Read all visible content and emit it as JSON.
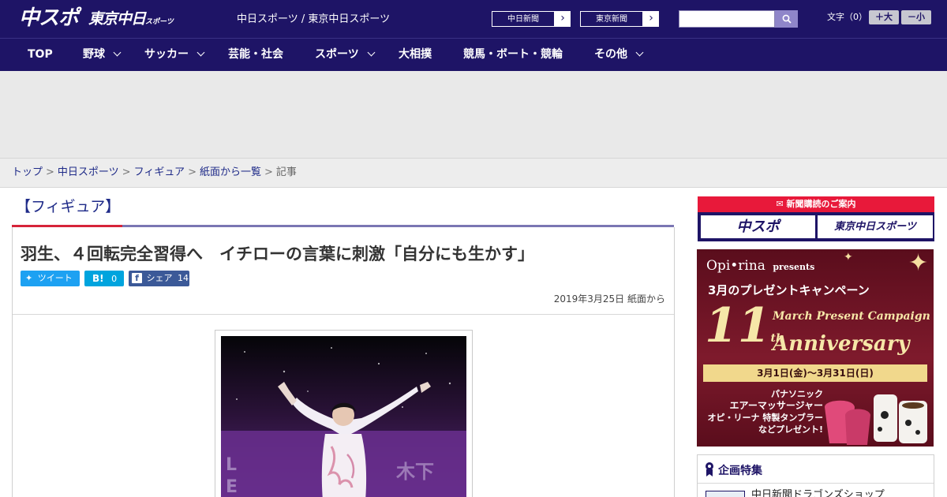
{
  "header": {
    "logo_main": "中スポ",
    "logo_tokyo": "東京中日",
    "logo_tokyo_suffix": "スポーツ",
    "site_link": "中日スポーツ / 東京中日スポーツ",
    "paper_links": [
      {
        "label": "中日新聞",
        "icon": "chevron-right-icon"
      },
      {
        "label": "東京新聞",
        "icon": "chevron-right-icon"
      }
    ],
    "search": {
      "placeholder": "",
      "icon": "search-icon"
    },
    "font_size": {
      "label": "文字（0）",
      "increase": "＋大",
      "decrease": "－小"
    }
  },
  "nav": {
    "items": [
      {
        "label": "TOP",
        "has_menu": false
      },
      {
        "label": "野球",
        "has_menu": true
      },
      {
        "label": "サッカー",
        "has_menu": true
      },
      {
        "label": "芸能・社会",
        "has_menu": false
      },
      {
        "label": "スポーツ",
        "has_menu": true
      },
      {
        "label": "大相撲",
        "has_menu": false
      },
      {
        "label": "競馬・ボート・競輪",
        "has_menu": false
      },
      {
        "label": "その他",
        "has_menu": true
      }
    ]
  },
  "breadcrumb": {
    "links": [
      "トップ",
      "中日スポーツ",
      "フィギュア",
      "紙面から一覧"
    ],
    "current": "記事",
    "separator": ">"
  },
  "article": {
    "category": "【フィギュア】",
    "headline": "羽生、４回転完全習得へ　イチローの言葉に刺激「自分にも生かす」",
    "share": {
      "tweet": "ツイート",
      "hatena": "B!",
      "hatena_count": "0",
      "facebook": "シェア",
      "facebook_count": "14"
    },
    "dateline": "2019年3月25日 紙面から"
  },
  "sidebar": {
    "subscribe_head": "新聞購読のご案内",
    "subscribe_tiles": [
      "中スポ",
      "東京中日スポーツ"
    ],
    "campaign": {
      "brand": "Opi•rina",
      "brand_suffix": "presents",
      "title": "3月のプレゼントキャンペーン",
      "number": "11",
      "number_suffix": "th",
      "line1": "March Present Campaign",
      "line2": "Anniversary",
      "period": "3月1日(金)〜3月31日(日)",
      "prize1": "パナソニック",
      "prize2": "エアーマッサージャー",
      "prize3": "オピ・リーナ 特製タンブラー",
      "prize4": "などプレゼント!"
    },
    "feature_head": "企画特集",
    "feature_item": "中日新聞ドラゴンズショップ"
  },
  "colors": {
    "brand_navy": "#1e1466",
    "accent_red": "#d6243a",
    "twitter": "#1da1f2",
    "hatena": "#00a4de",
    "facebook": "#3b5998"
  }
}
